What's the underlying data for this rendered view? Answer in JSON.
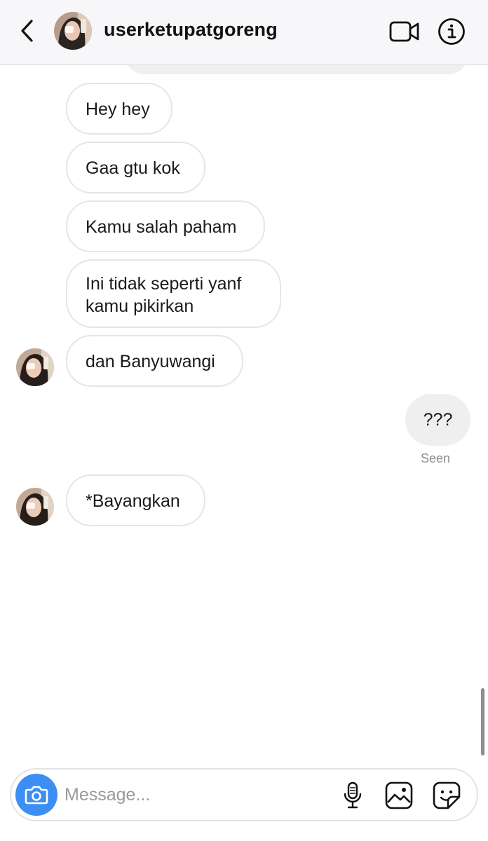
{
  "header": {
    "username": "userketupatgoreng",
    "back_icon": "chevron-left-icon",
    "video_icon": "video-camera-icon",
    "info_icon": "info-icon"
  },
  "messages": [
    {
      "direction": "incoming",
      "text": "Hey hey"
    },
    {
      "direction": "incoming",
      "text": "Gaa gtu kok"
    },
    {
      "direction": "incoming",
      "text": "Kamu salah paham"
    },
    {
      "direction": "incoming",
      "lines": [
        "Ini tidak seperti yanf",
        "kamu pikirkan"
      ]
    },
    {
      "direction": "incoming",
      "text": "dan Banyuwangi",
      "avatar": true
    },
    {
      "direction": "outgoing",
      "text": "???",
      "status": "Seen"
    },
    {
      "direction": "incoming",
      "text": "*Bayangkan",
      "avatar": true
    }
  ],
  "composer": {
    "placeholder": "Message...",
    "camera_icon": "camera-icon",
    "mic_icon": "microphone-icon",
    "gallery_icon": "image-icon",
    "sticker_icon": "sticker-icon"
  },
  "colors": {
    "header_bg": "#f7f6f8",
    "accent_blue": "#3d8ef2",
    "incoming_border": "#e6e6e6",
    "outgoing_bg": "#efefef",
    "muted_text": "#8e8e8e"
  }
}
